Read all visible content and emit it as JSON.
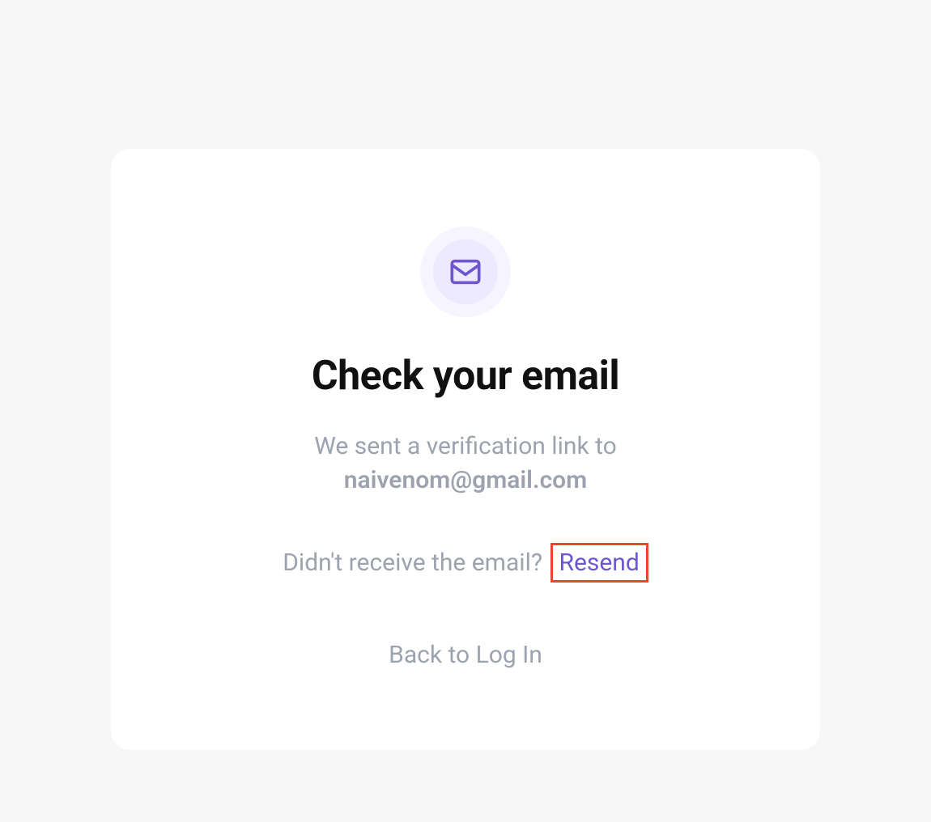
{
  "heading": "Check your email",
  "subtext_prefix": "We sent a verification link to",
  "email": "naivenom@gmail.com",
  "resend_prompt": "Didn't receive the email? ",
  "resend_label": "Resend",
  "back_label": "Back to Log In"
}
